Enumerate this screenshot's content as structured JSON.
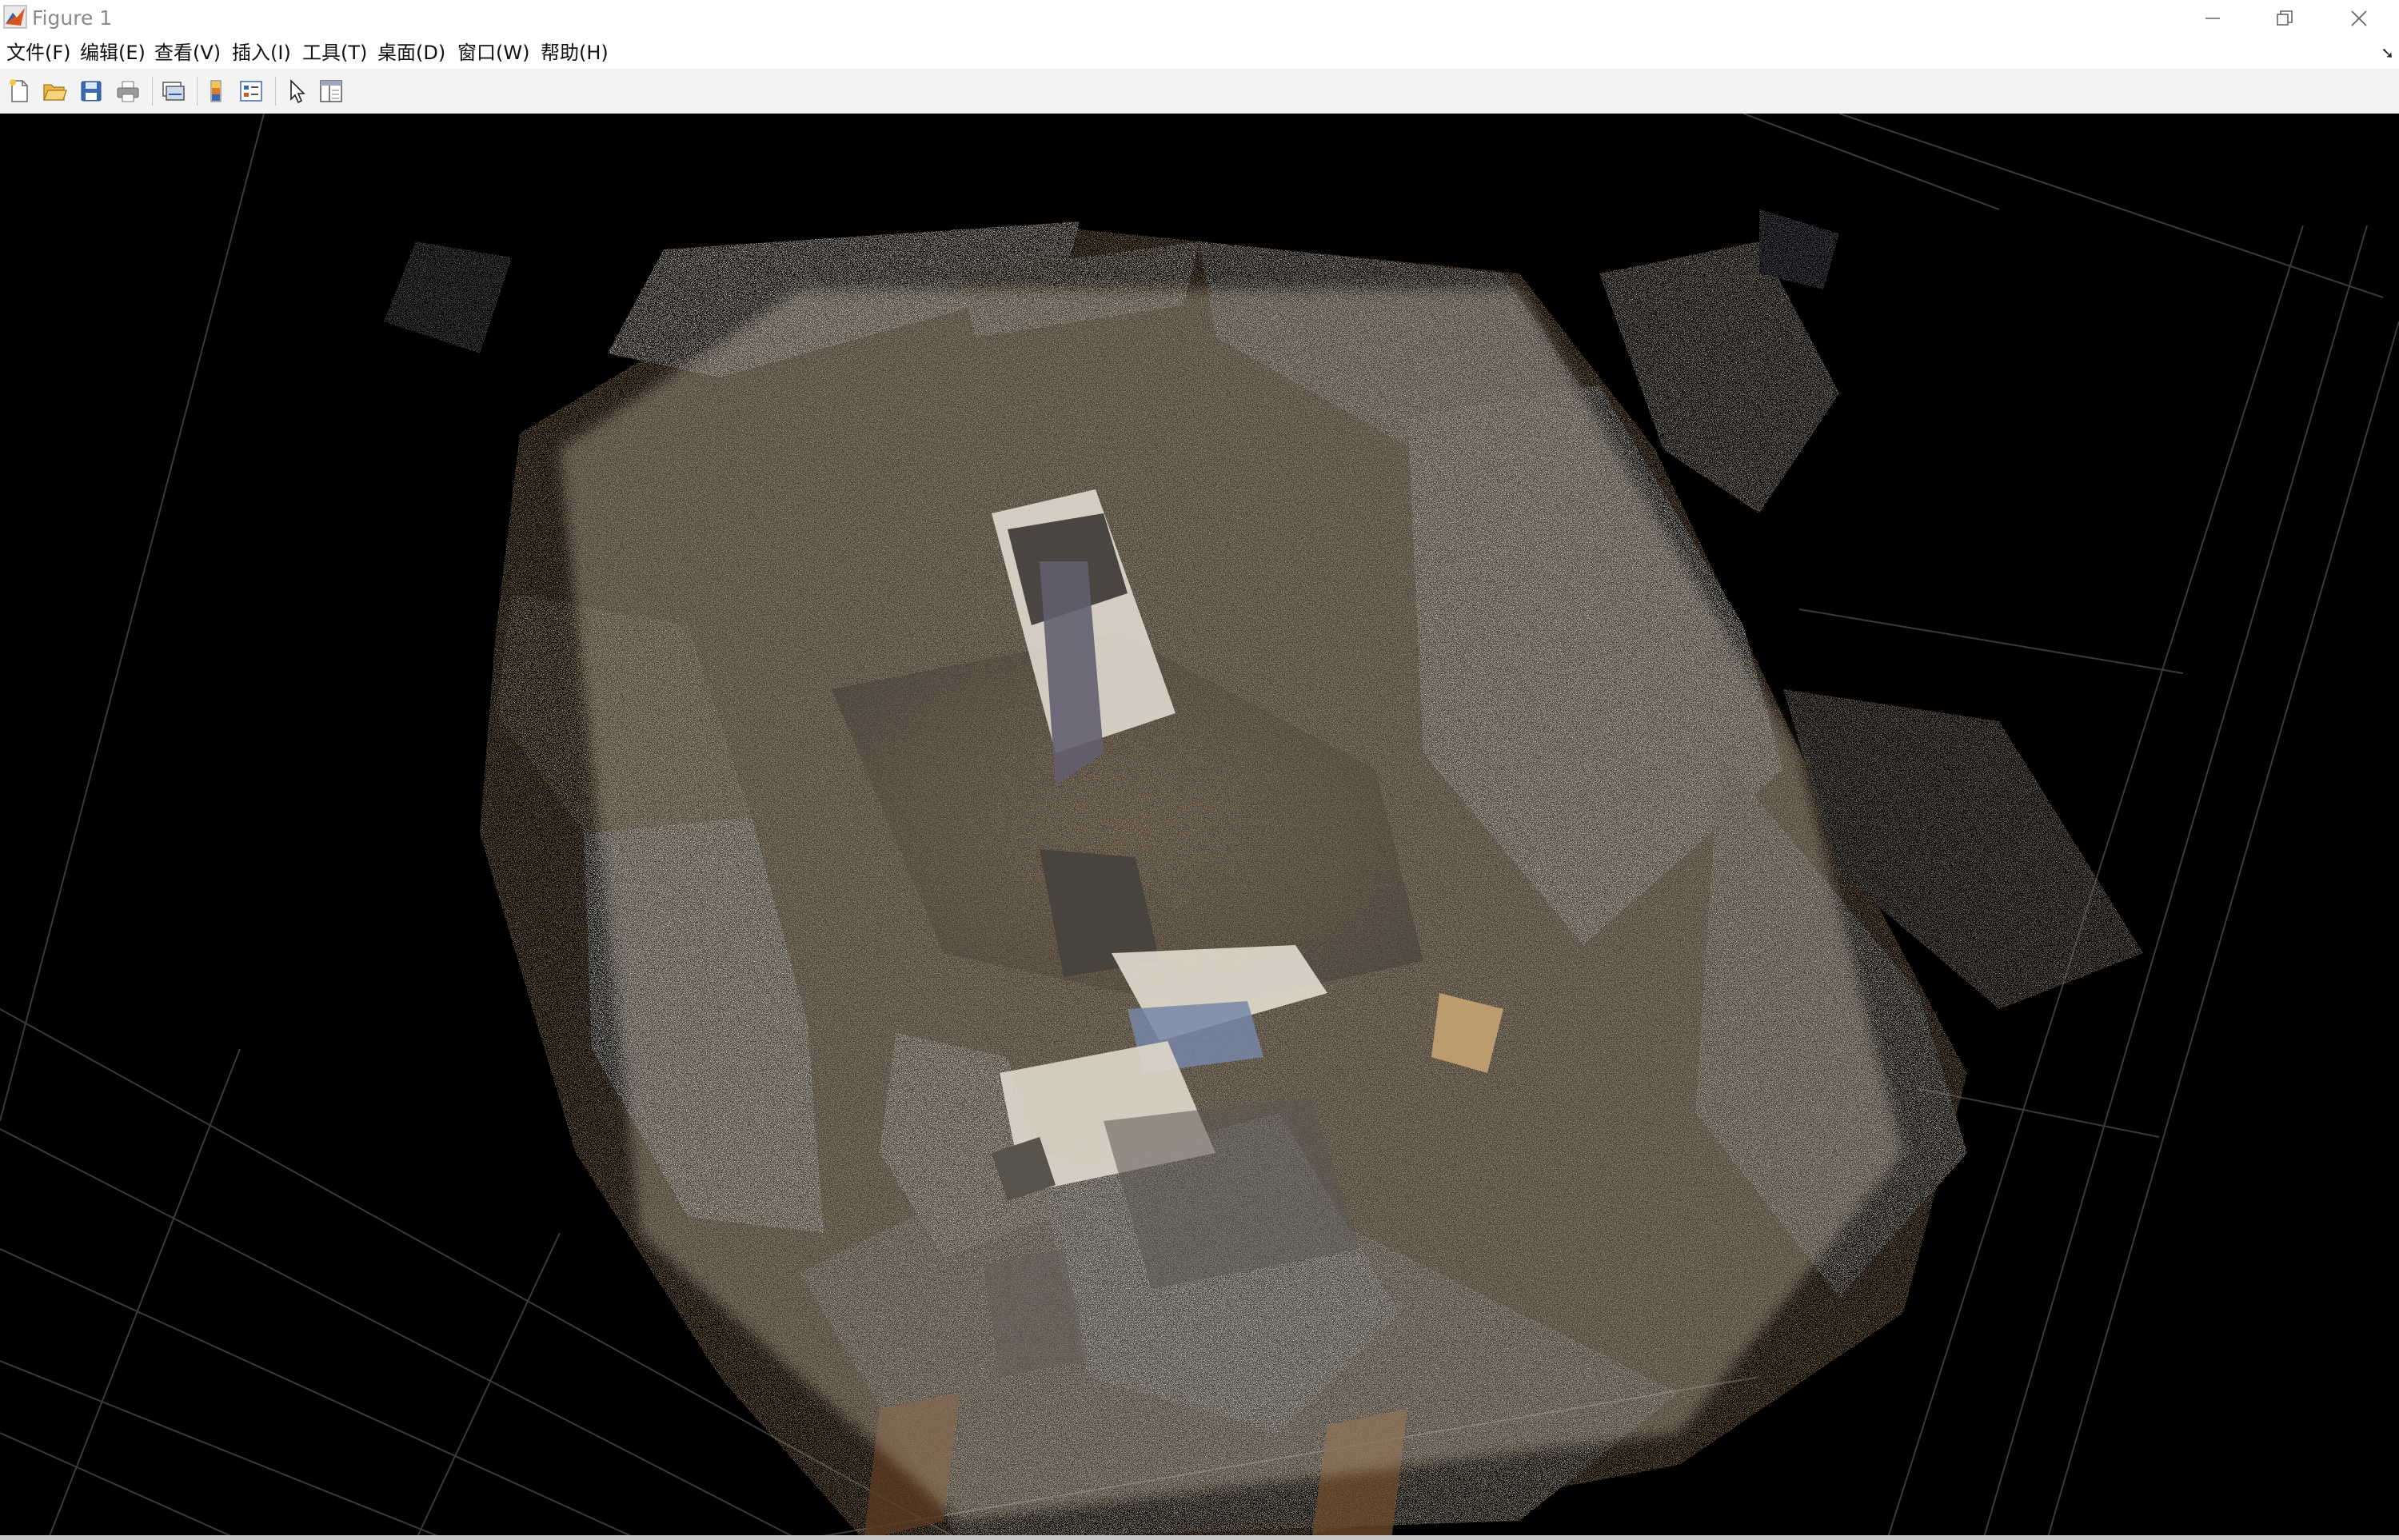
{
  "window": {
    "title": "Figure 1",
    "controls": [
      "minimize-icon",
      "restore-icon",
      "close-icon"
    ]
  },
  "menubar": {
    "items": [
      {
        "label": "文件(F)"
      },
      {
        "label": "编辑(E)"
      },
      {
        "label": "查看(V)"
      },
      {
        "label": "插入(I)"
      },
      {
        "label": "工具(T)"
      },
      {
        "label": "桌面(D)"
      },
      {
        "label": "窗口(W)"
      },
      {
        "label": "帮助(H)"
      }
    ]
  },
  "toolbar": {
    "buttons": [
      {
        "icon": "new-figure-icon"
      },
      {
        "icon": "open-file-icon"
      },
      {
        "icon": "save-icon"
      },
      {
        "icon": "print-icon"
      },
      {
        "icon": "link-plot-icon"
      },
      {
        "icon": "colorbar-icon"
      },
      {
        "icon": "legend-icon"
      },
      {
        "icon": "select-pointer-icon"
      },
      {
        "icon": "property-editor-icon"
      }
    ]
  },
  "figure": {
    "content": "3d-point-cloud-room",
    "background": "#000000",
    "grid_color": "#3a3a3a",
    "palette": [
      "#ffffff",
      "#e8e2d6",
      "#c9b08a",
      "#8a6a45",
      "#5a4632",
      "#1c1c30"
    ]
  }
}
